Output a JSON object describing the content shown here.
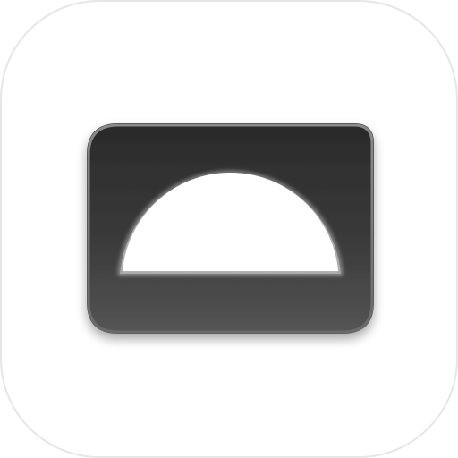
{
  "app_icon": {
    "icon_name": "protractor-icon",
    "colors": {
      "tile_background": "#ffffff",
      "tile_border": "#e6e6e6",
      "glyph_dark": "#2b2b2b",
      "glyph_mid": "#4a4a4a",
      "glyph_edge": "#7a7a7a",
      "cutout": "#ffffff"
    }
  }
}
